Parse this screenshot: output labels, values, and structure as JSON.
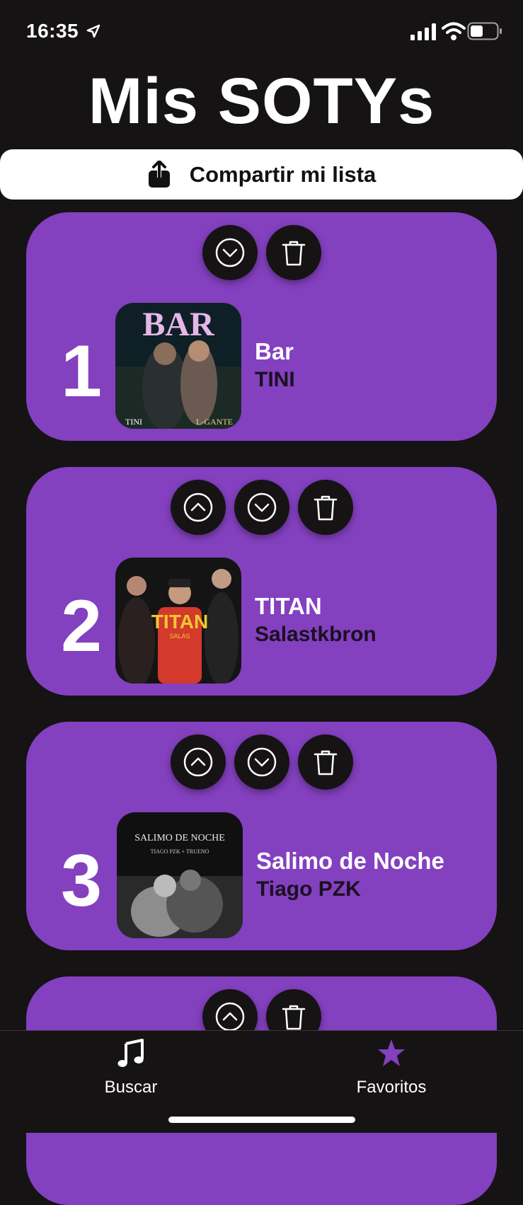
{
  "status_bar": {
    "time": "16:35"
  },
  "header": {
    "title": "Mis SOTYs"
  },
  "share": {
    "label": "Compartir mi lista"
  },
  "songs": [
    {
      "rank": "1",
      "title": "Bar",
      "artist": "TINI",
      "cover_text": "BAR",
      "cover_sub": [
        "TINI",
        "L-GANTE"
      ]
    },
    {
      "rank": "2",
      "title": "TITAN",
      "artist": "Salastkbron",
      "cover_text": "TITAN",
      "cover_sub": [
        "SALAS"
      ]
    },
    {
      "rank": "3",
      "title": "Salimo de Noche",
      "artist": "Tiago PZK",
      "cover_text": "SALIMO DE NOCHE",
      "cover_sub": [
        "TIAGO PZK + TRUENO"
      ]
    }
  ],
  "tabs": [
    {
      "label": "Buscar",
      "icon": "music-note-icon"
    },
    {
      "label": "Favoritos",
      "icon": "star-icon"
    }
  ],
  "colors": {
    "card": "#8340bf",
    "background": "#161314",
    "accent": "#8340bf"
  }
}
